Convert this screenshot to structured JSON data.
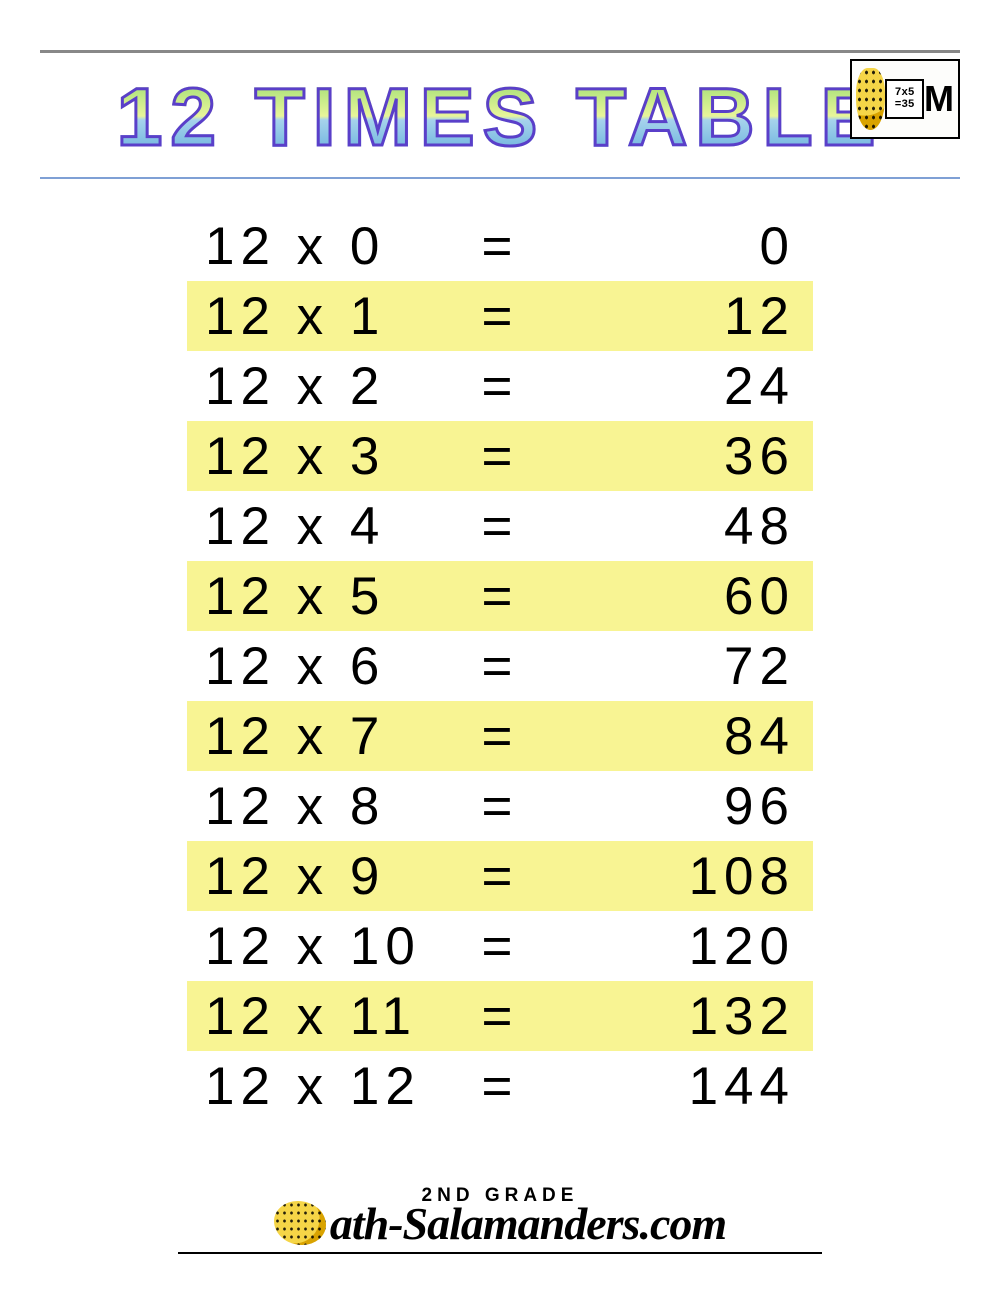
{
  "header": {
    "title": "12 Times Table",
    "badge_expr_top": "7x5",
    "badge_expr_bottom": "=35",
    "badge_letter": "M"
  },
  "chart_data": {
    "type": "table",
    "title": "12 Times Table",
    "base": 12,
    "rows": [
      {
        "a": 12,
        "b": 0,
        "result": 0,
        "highlight": false
      },
      {
        "a": 12,
        "b": 1,
        "result": 12,
        "highlight": true
      },
      {
        "a": 12,
        "b": 2,
        "result": 24,
        "highlight": false
      },
      {
        "a": 12,
        "b": 3,
        "result": 36,
        "highlight": true
      },
      {
        "a": 12,
        "b": 4,
        "result": 48,
        "highlight": false
      },
      {
        "a": 12,
        "b": 5,
        "result": 60,
        "highlight": true
      },
      {
        "a": 12,
        "b": 6,
        "result": 72,
        "highlight": false
      },
      {
        "a": 12,
        "b": 7,
        "result": 84,
        "highlight": true
      },
      {
        "a": 12,
        "b": 8,
        "result": 96,
        "highlight": false
      },
      {
        "a": 12,
        "b": 9,
        "result": 108,
        "highlight": true
      },
      {
        "a": 12,
        "b": 10,
        "result": 120,
        "highlight": false
      },
      {
        "a": 12,
        "b": 11,
        "result": 132,
        "highlight": true
      },
      {
        "a": 12,
        "b": 12,
        "result": 144,
        "highlight": false
      }
    ],
    "symbol_multiply": "x",
    "symbol_equals": "="
  },
  "footer": {
    "grade": "2nd Grade",
    "brand": "ath-Salamanders.com"
  }
}
